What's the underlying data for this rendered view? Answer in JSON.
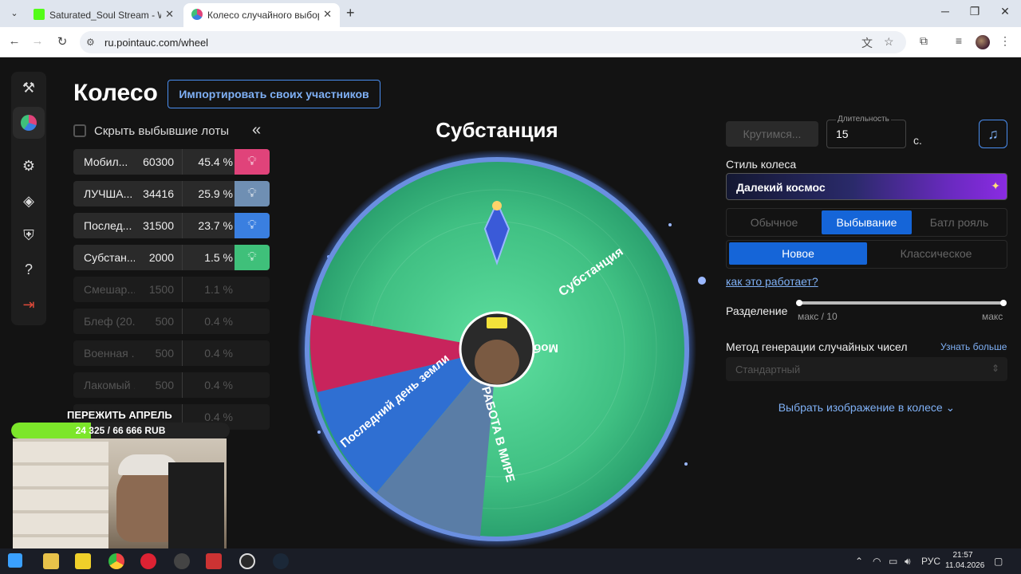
{
  "browser": {
    "tabs": [
      {
        "title": "Saturated_Soul Stream - Watch",
        "active": false
      },
      {
        "title": "Колесо случайного выбора - P",
        "active": true
      }
    ],
    "url": "ru.pointauc.com/wheel"
  },
  "page": {
    "title": "Колесо",
    "import_button": "Импортировать своих участников",
    "hide_label": "Скрыть выбывшие лоты",
    "collapse_icon": "«"
  },
  "lots": [
    {
      "name": "Мобил...",
      "amount": "60300",
      "percent": "45.4 %",
      "color": "#e0437a",
      "eliminated": false
    },
    {
      "name": "ЛУЧША...",
      "amount": "34416",
      "percent": "25.9 %",
      "color": "#6f8fb3",
      "eliminated": false
    },
    {
      "name": "Послед...",
      "amount": "31500",
      "percent": "23.7 %",
      "color": "#3a7fe0",
      "eliminated": false
    },
    {
      "name": "Субстан...",
      "amount": "2000",
      "percent": "1.5 %",
      "color": "#3fc07a",
      "eliminated": false
    },
    {
      "name": "Смешар...",
      "amount": "1500",
      "percent": "1.1 %",
      "eliminated": true
    },
    {
      "name": "Блеф (20...",
      "amount": "500",
      "percent": "0.4 %",
      "eliminated": true
    },
    {
      "name": "Военная ...",
      "amount": "500",
      "percent": "0.4 %",
      "eliminated": true
    },
    {
      "name": "Лакомый ...",
      "amount": "500",
      "percent": "0.4 %",
      "eliminated": true
    },
    {
      "name": "",
      "amount": "",
      "percent": "0.4 %",
      "eliminated": true
    }
  ],
  "wheel": {
    "winner": "Субстанция",
    "segments": [
      {
        "label": "Мобильник",
        "color": "#c8245c"
      },
      {
        "label": "Последний день земли",
        "color": "#2f6fd2"
      },
      {
        "label": "Я РАБОТА В МИРЕ",
        "color": "#5a7da6"
      },
      {
        "label": "Субстанция",
        "color": "#3fbf82"
      }
    ]
  },
  "controls": {
    "spin_button": "Крутимся...",
    "duration_label": "Длительность",
    "duration_value": "15",
    "duration_unit": "с.",
    "style_label": "Стиль колеса",
    "style_value": "Далекий космос",
    "modes": [
      "Обычное",
      "Выбывание",
      "Батл рояль"
    ],
    "active_mode": "Выбывание",
    "variants": [
      "Новое",
      "Классическое"
    ],
    "active_variant": "Новое",
    "how_link": "как это работает?",
    "split_label": "Разделение",
    "split_min": "макс / 10",
    "split_max": "макс",
    "rng_label": "Метод генерации случайных чисел",
    "rng_more": "Узнать больше",
    "rng_value": "Стандартный",
    "image_pick": "Выбрать изображение в колесе"
  },
  "overlay": {
    "title": "ПЕРЕЖИТЬ АПРЕЛЬ",
    "goal_text": "24 325 / 66 666 RUB",
    "goal_fraction": 0.365
  },
  "system": {
    "language": "РУС",
    "time": "21:57",
    "date": "11.04.2026"
  },
  "colors": {
    "accent": "#1565d8",
    "link": "#7fb0f5",
    "wheel_bg": "#3fbf82"
  }
}
